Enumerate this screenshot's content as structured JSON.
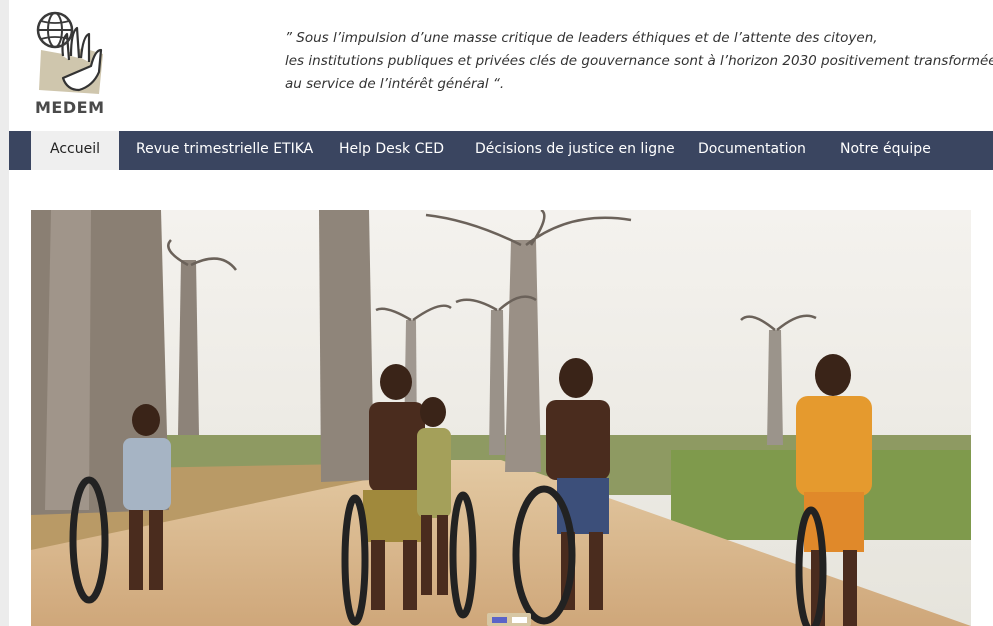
{
  "site": {
    "logo_text": "MEDEM"
  },
  "header": {
    "quote_lines": [
      "” Sous l’impulsion d’une masse critique de leaders éthiques et de l’attente des citoyen,",
      "les institutions publiques et privées clés de gouvernance sont à l’horizon 2030 positivement transformées",
      "au service de l’intérêt général “."
    ]
  },
  "nav": {
    "items": [
      {
        "label": "Accueil",
        "active": true
      },
      {
        "label": "Revue trimestrielle ETIKA",
        "active": false
      },
      {
        "label": "Help Desk CED",
        "active": false
      },
      {
        "label": "Décisions de justice en ligne",
        "active": false
      },
      {
        "label": "Documentation",
        "active": false
      },
      {
        "label": "Notre équipe",
        "active": false
      }
    ]
  },
  "slider": {
    "slide_count": 2,
    "active_slide": 1
  },
  "colors": {
    "navbar": "#3a4560",
    "active_tab_bg": "#efefef",
    "pager_active": "#5a64c8",
    "pager_inactive": "#ffffff"
  }
}
